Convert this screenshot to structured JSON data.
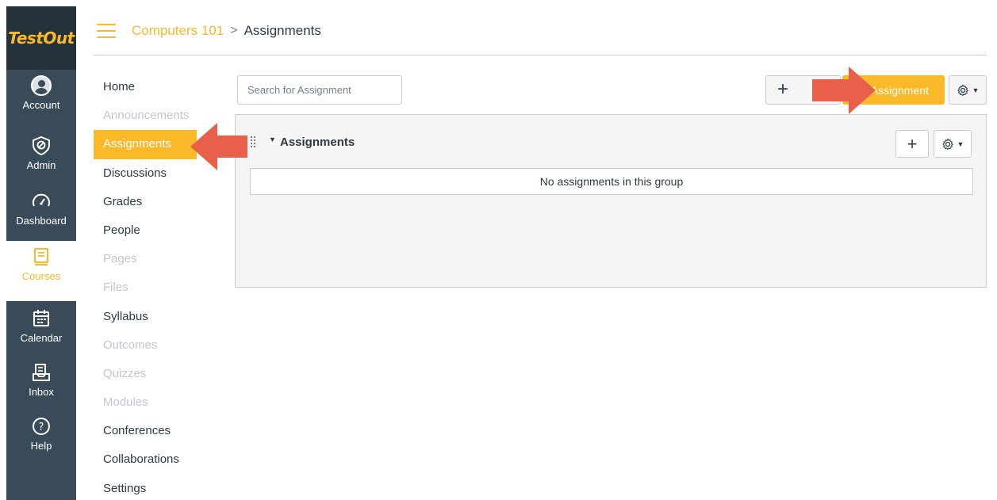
{
  "logo": {
    "text": "TestOut"
  },
  "global_nav": [
    {
      "label": "Account",
      "icon": "account-avatar-icon"
    },
    {
      "label": "Admin",
      "icon": "shield-icon"
    },
    {
      "label": "Dashboard",
      "icon": "speedometer-icon"
    },
    {
      "label": "Courses",
      "icon": "book-icon",
      "active": true
    },
    {
      "label": "Calendar",
      "icon": "calendar-icon"
    },
    {
      "label": "Inbox",
      "icon": "inbox-icon"
    },
    {
      "label": "Help",
      "icon": "help-icon"
    }
  ],
  "breadcrumb": {
    "course": "Computers 101",
    "separator": ">",
    "current": "Assignments"
  },
  "course_nav": [
    {
      "label": "Home",
      "state": "normal"
    },
    {
      "label": "Announcements",
      "state": "disabled"
    },
    {
      "label": "Assignments",
      "state": "active"
    },
    {
      "label": "Discussions",
      "state": "normal"
    },
    {
      "label": "Grades",
      "state": "normal"
    },
    {
      "label": "People",
      "state": "normal"
    },
    {
      "label": "Pages",
      "state": "disabled"
    },
    {
      "label": "Files",
      "state": "disabled"
    },
    {
      "label": "Syllabus",
      "state": "normal"
    },
    {
      "label": "Outcomes",
      "state": "disabled"
    },
    {
      "label": "Quizzes",
      "state": "disabled"
    },
    {
      "label": "Modules",
      "state": "disabled"
    },
    {
      "label": "Conferences",
      "state": "normal"
    },
    {
      "label": "Collaborations",
      "state": "normal"
    },
    {
      "label": "Settings",
      "state": "normal"
    }
  ],
  "toolbar": {
    "search_placeholder": "Search for Assignment",
    "add_assignment_label": "Assignment",
    "add_symbol": "+"
  },
  "group": {
    "title": "Assignments",
    "empty_message": "No assignments in this group"
  },
  "colors": {
    "accent": "#f9b928",
    "nav_bg": "#394b58",
    "callout_arrow": "#e8604a"
  }
}
